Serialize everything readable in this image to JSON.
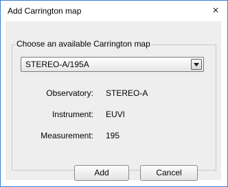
{
  "window": {
    "title": "Add Carrington map",
    "close_glyph": "×"
  },
  "group": {
    "label": "Choose an available Carrington map"
  },
  "map_select": {
    "selected": "STEREO-A/195A"
  },
  "info": {
    "observatory_label": "Observatory:",
    "observatory_value": "STEREO-A",
    "instrument_label": "Instrument:",
    "instrument_value": "EUVI",
    "measurement_label": "Measurement:",
    "measurement_value": "195"
  },
  "buttons": {
    "add": "Add",
    "cancel": "Cancel"
  },
  "colors": {
    "window_border": "#3a7bd5",
    "panel_bg": "#eeeeee"
  }
}
